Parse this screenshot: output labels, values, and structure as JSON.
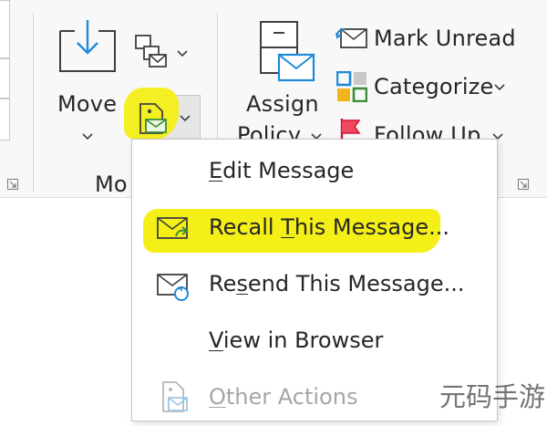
{
  "ribbon": {
    "move": {
      "label": "Move"
    },
    "group_move_label": "Mo",
    "assign_policy": {
      "line1": "Assign",
      "line2": "Policy"
    },
    "mark_unread": {
      "label": "Mark Unread"
    },
    "categorize": {
      "label": "Categorize"
    },
    "follow_up": {
      "label": "Follow Up"
    }
  },
  "menu": {
    "items": [
      {
        "pre": "",
        "key": "E",
        "post": "dit Message",
        "enabled": true,
        "icon": "none"
      },
      {
        "pre": "Recall ",
        "key": "T",
        "post": "his Message...",
        "enabled": true,
        "icon": "recall-envelope-icon",
        "highlighted": true
      },
      {
        "pre": "Re",
        "key": "s",
        "post": "end This Message...",
        "enabled": true,
        "icon": "resend-envelope-icon"
      },
      {
        "pre": "",
        "key": "V",
        "post": "iew in Browser",
        "enabled": true,
        "icon": "none"
      },
      {
        "pre": "",
        "key": "O",
        "post": "ther Actions",
        "enabled": false,
        "icon": "other-actions-icon"
      }
    ]
  },
  "colors": {
    "highlight": "#f4ef17",
    "accent_blue": "#1e8bd6",
    "accent_green": "#3a8d3a",
    "accent_red": "#d0193a"
  },
  "watermark": "元码手游网"
}
